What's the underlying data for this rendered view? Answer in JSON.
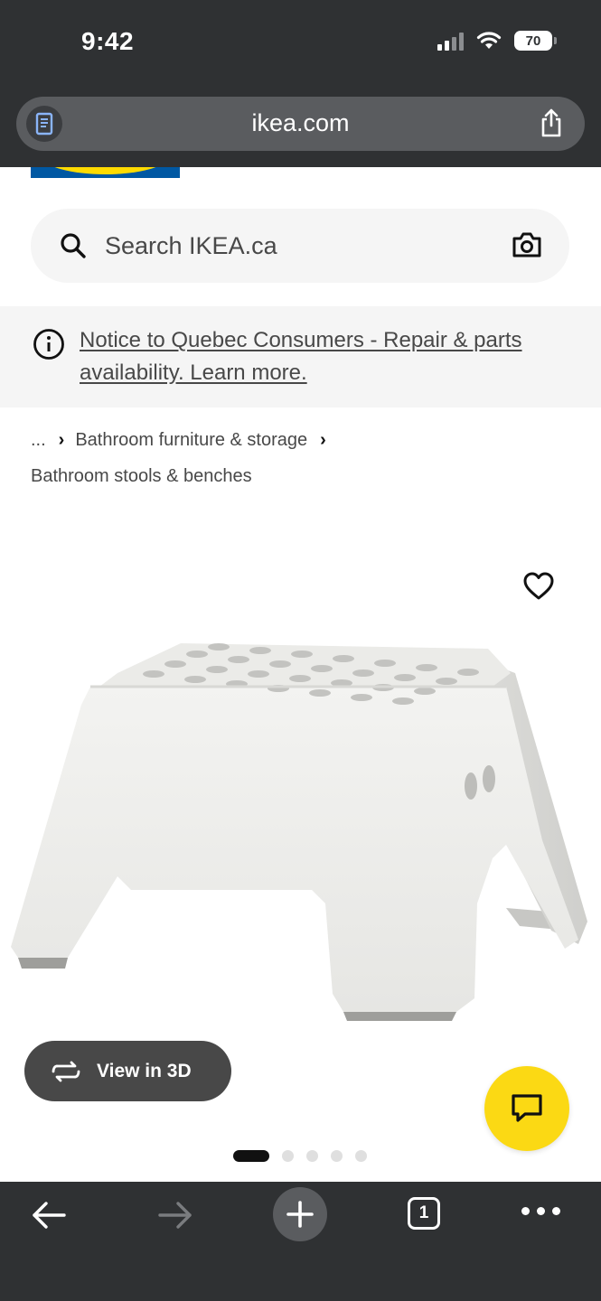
{
  "status_bar": {
    "time": "9:42",
    "battery": "70",
    "signal_icon": "cellular-signal-icon",
    "wifi_icon": "wifi-icon"
  },
  "browser": {
    "url": "ikea.com",
    "reader_icon": "reader-mode-icon",
    "share_icon": "share-icon",
    "tab_count": "1"
  },
  "search": {
    "placeholder": "Search IKEA.ca",
    "search_icon": "search-icon",
    "camera_icon": "camera-icon"
  },
  "notice": {
    "text": "Notice to Quebec Consumers - Repair & parts availability. Learn more.",
    "icon": "info-icon"
  },
  "breadcrumb": {
    "ellipsis": "...",
    "items": [
      "Bathroom furniture & storage",
      "Bathroom stools & benches"
    ]
  },
  "product": {
    "favourite_icon": "heart-icon",
    "view3d_label": "View in 3D",
    "view3d_icon": "rotate-3d-icon",
    "chat_icon": "chat-icon",
    "image_count": 5,
    "active_image": 1
  },
  "colors": {
    "ikea_blue": "#0058a3",
    "ikea_yellow": "#ffdb00",
    "chat_yellow": "#fbd914",
    "browser_chrome": "#2f3133"
  }
}
